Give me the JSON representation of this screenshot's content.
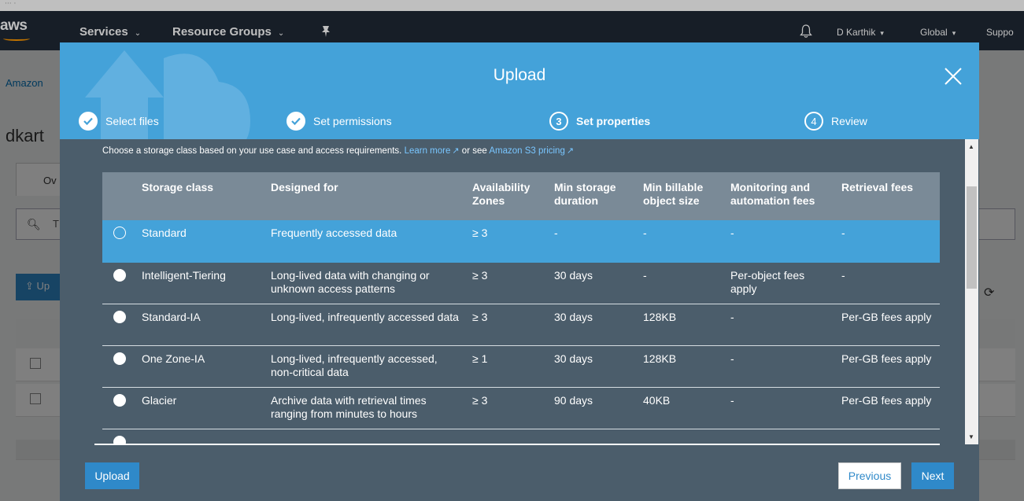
{
  "nav": {
    "logo": "aws",
    "services": "Services",
    "resource_groups": "Resource Groups",
    "user": "D Karthik",
    "region": "Global",
    "support": "Suppo"
  },
  "background": {
    "breadcrumb": "Amazon",
    "bucket_title": "dkart",
    "tab_overview": "Ov",
    "search_placeholder": "T",
    "upload_label": "Up"
  },
  "modal": {
    "title": "Upload",
    "steps": [
      {
        "number": "1",
        "label": "Select files",
        "status": "done"
      },
      {
        "number": "2",
        "label": "Set permissions",
        "status": "done"
      },
      {
        "number": "3",
        "label": "Set properties",
        "status": "active"
      },
      {
        "number": "4",
        "label": "Review",
        "status": "pending"
      }
    ],
    "intro_text": "Choose a storage class based on your use case and access requirements.",
    "learn_more": "Learn more",
    "or_see": "or see",
    "pricing_link": "Amazon S3 pricing",
    "table": {
      "headers": [
        "Storage class",
        "Designed for",
        "Availability Zones",
        "Min storage duration",
        "Min billable object size",
        "Monitoring and automation fees",
        "Retrieval fees"
      ],
      "rows": [
        {
          "name": "Standard",
          "designed_for": "Frequently accessed data",
          "az": "≥ 3",
          "min_duration": "-",
          "min_size": "-",
          "monitoring": "-",
          "retrieval": "-",
          "selected": true
        },
        {
          "name": "Intelligent-Tiering",
          "designed_for": "Long-lived data with changing or unknown access patterns",
          "az": "≥ 3",
          "min_duration": "30 days",
          "min_size": "-",
          "monitoring": "Per-object fees apply",
          "retrieval": "-",
          "selected": false
        },
        {
          "name": "Standard-IA",
          "designed_for": "Long-lived, infrequently accessed data",
          "az": "≥ 3",
          "min_duration": "30 days",
          "min_size": "128KB",
          "monitoring": "-",
          "retrieval": "Per-GB fees apply",
          "selected": false
        },
        {
          "name": "One Zone-IA",
          "designed_for": "Long-lived, infrequently accessed, non-critical data",
          "az": "≥ 1",
          "min_duration": "30 days",
          "min_size": "128KB",
          "monitoring": "-",
          "retrieval": "Per-GB fees apply",
          "selected": false
        },
        {
          "name": "Glacier",
          "designed_for": "Archive data with retrieval times ranging from minutes to hours",
          "az": "≥ 3",
          "min_duration": "90 days",
          "min_size": "40KB",
          "monitoring": "-",
          "retrieval": "Per-GB fees apply",
          "selected": false
        }
      ]
    },
    "buttons": {
      "upload": "Upload",
      "previous": "Previous",
      "next": "Next"
    }
  },
  "colors": {
    "nav_bg": "#1f2835",
    "modal_header": "#44a2d9",
    "modal_body": "#4b5d6b",
    "table_header": "#7a8a97",
    "selected_row": "#44a2d9",
    "primary_button": "#2f89c9",
    "link": "#79c6ff"
  }
}
